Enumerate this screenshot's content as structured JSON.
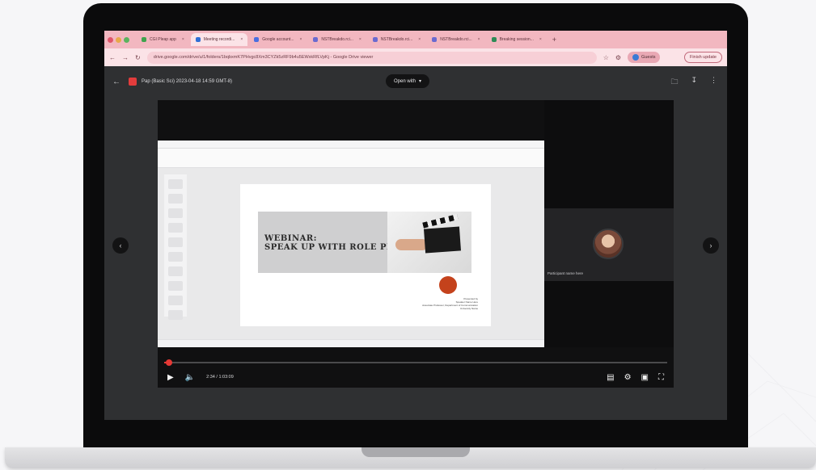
{
  "browser": {
    "tabs": [
      {
        "label": "CGI Pleap app",
        "color": "#3fa34d"
      },
      {
        "label": "Meeting recordi...",
        "color": "#2f6fd6",
        "active": true
      },
      {
        "label": "Google account...",
        "color": "#4a6ee0"
      },
      {
        "label": "NSTBreakdo.rci...",
        "color": "#6a6ad0"
      },
      {
        "label": "NSTBreakdo.rci...",
        "color": "#6a6ad0"
      },
      {
        "label": "NSTBreakdo.rci...",
        "color": "#6a6ad0"
      },
      {
        "label": "Breaking session...",
        "color": "#2e8b57"
      }
    ],
    "new_tab": "+",
    "url": "drive.google.com/drive/u/1/folders/1bqbxmK7PHvgc8Xm3CYZk5zRF9b4u5EWxkRfLVpKj - Google Drive viewer",
    "profile": "Guests",
    "update_label": "Finish update"
  },
  "viewer": {
    "file_name": "Pap (Basic Sci) 2023-04-18 14:59 GMT-8)",
    "open_with": "Open with"
  },
  "slide": {
    "title": "WEBINAR:\nSPEAK UP WITH ROLE PLAY",
    "credits": "Presented by\nSpeaker Name Here\nAssociate Professor, Department of Communication\nUniversity Name"
  },
  "camera": {
    "participant_name": "Participant name here"
  },
  "player": {
    "timecode": "2:34 / 1:03:09",
    "progress": 0.01
  }
}
